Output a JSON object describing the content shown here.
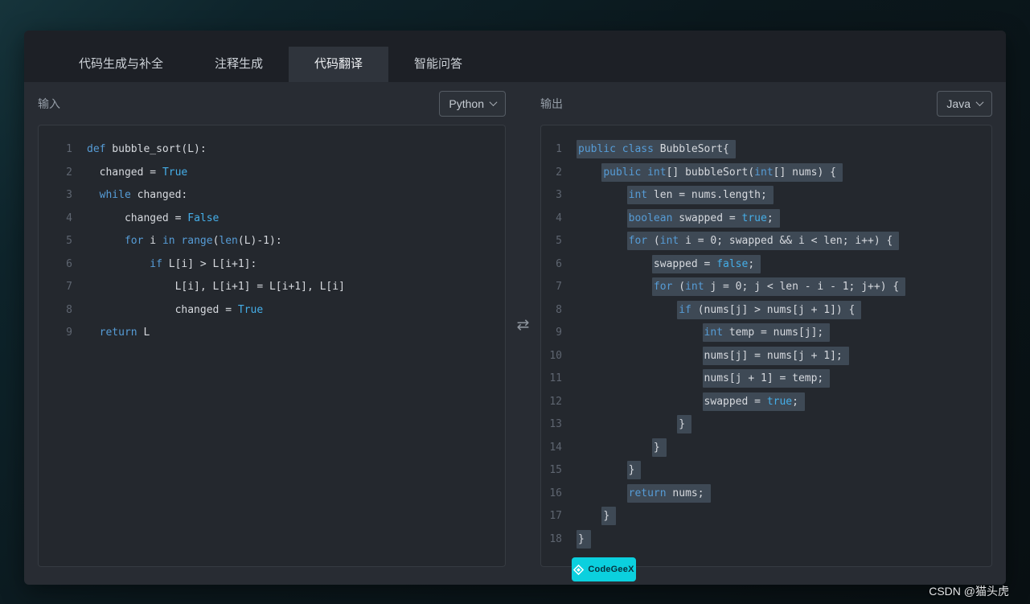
{
  "tabs": [
    {
      "id": "code-generation",
      "label": "代码生成与补全",
      "active": false
    },
    {
      "id": "comment-generation",
      "label": "注释生成",
      "active": false
    },
    {
      "id": "code-translation",
      "label": "代码翻译",
      "active": true
    },
    {
      "id": "smart-qa",
      "label": "智能问答",
      "active": false
    }
  ],
  "panels": {
    "input": {
      "label": "输入",
      "language": "Python",
      "lines": [
        {
          "n": 1,
          "indent": 0,
          "tokens": [
            [
              "k",
              "def"
            ],
            [
              "p",
              " bubble_sort(L):"
            ]
          ]
        },
        {
          "n": 2,
          "indent": 2,
          "tokens": [
            [
              "p",
              "changed = "
            ],
            [
              "l",
              "True"
            ]
          ]
        },
        {
          "n": 3,
          "indent": 2,
          "tokens": [
            [
              "k",
              "while"
            ],
            [
              "p",
              " changed:"
            ]
          ]
        },
        {
          "n": 4,
          "indent": 6,
          "tokens": [
            [
              "p",
              "changed = "
            ],
            [
              "l",
              "False"
            ]
          ]
        },
        {
          "n": 5,
          "indent": 6,
          "tokens": [
            [
              "k",
              "for"
            ],
            [
              "p",
              " i "
            ],
            [
              "k",
              "in"
            ],
            [
              "p",
              " "
            ],
            [
              "k",
              "range"
            ],
            [
              "p",
              "("
            ],
            [
              "k",
              "len"
            ],
            [
              "p",
              "(L)-1):"
            ]
          ]
        },
        {
          "n": 6,
          "indent": 10,
          "tokens": [
            [
              "k",
              "if"
            ],
            [
              "p",
              " L[i] > L[i+1]:"
            ]
          ]
        },
        {
          "n": 7,
          "indent": 14,
          "tokens": [
            [
              "p",
              "L[i], L[i+1] = L[i+1], L[i]"
            ]
          ]
        },
        {
          "n": 8,
          "indent": 14,
          "tokens": [
            [
              "p",
              "changed = "
            ],
            [
              "l",
              "True"
            ]
          ]
        },
        {
          "n": 9,
          "indent": 2,
          "tokens": [
            [
              "k",
              "return"
            ],
            [
              "p",
              " L"
            ]
          ]
        }
      ]
    },
    "output": {
      "label": "输出",
      "language": "Java",
      "lines": [
        {
          "n": 1,
          "indent": 0,
          "tokens": [
            [
              "k",
              "public"
            ],
            [
              "p",
              " "
            ],
            [
              "k",
              "class"
            ],
            [
              "p",
              " BubbleSort{"
            ]
          ]
        },
        {
          "n": 2,
          "indent": 4,
          "tokens": [
            [
              "k",
              "public"
            ],
            [
              "p",
              " "
            ],
            [
              "k",
              "int"
            ],
            [
              "p",
              "[] bubbleSort("
            ],
            [
              "k",
              "int"
            ],
            [
              "p",
              "[] nums) {"
            ]
          ]
        },
        {
          "n": 3,
          "indent": 8,
          "tokens": [
            [
              "k",
              "int"
            ],
            [
              "p",
              " len = nums.length;"
            ]
          ]
        },
        {
          "n": 4,
          "indent": 8,
          "tokens": [
            [
              "k",
              "boolean"
            ],
            [
              "p",
              " swapped = "
            ],
            [
              "l",
              "true"
            ],
            [
              "p",
              ";"
            ]
          ]
        },
        {
          "n": 5,
          "indent": 8,
          "tokens": [
            [
              "k",
              "for"
            ],
            [
              "p",
              " ("
            ],
            [
              "k",
              "int"
            ],
            [
              "p",
              " i = 0; swapped && i < len; i++) {"
            ]
          ]
        },
        {
          "n": 6,
          "indent": 12,
          "tokens": [
            [
              "p",
              "swapped = "
            ],
            [
              "l",
              "false"
            ],
            [
              "p",
              ";"
            ]
          ]
        },
        {
          "n": 7,
          "indent": 12,
          "tokens": [
            [
              "k",
              "for"
            ],
            [
              "p",
              " ("
            ],
            [
              "k",
              "int"
            ],
            [
              "p",
              " j = 0; j < len - i - 1; j++) {"
            ]
          ]
        },
        {
          "n": 8,
          "indent": 16,
          "tokens": [
            [
              "k",
              "if"
            ],
            [
              "p",
              " (nums[j] > nums[j + 1]) {"
            ]
          ]
        },
        {
          "n": 9,
          "indent": 20,
          "tokens": [
            [
              "k",
              "int"
            ],
            [
              "p",
              " temp = nums[j];"
            ]
          ]
        },
        {
          "n": 10,
          "indent": 20,
          "tokens": [
            [
              "p",
              "nums[j] = nums[j + 1];"
            ]
          ]
        },
        {
          "n": 11,
          "indent": 20,
          "tokens": [
            [
              "p",
              "nums[j + 1] = temp;"
            ]
          ]
        },
        {
          "n": 12,
          "indent": 20,
          "tokens": [
            [
              "p",
              "swapped = "
            ],
            [
              "l",
              "true"
            ],
            [
              "p",
              ";"
            ]
          ]
        },
        {
          "n": 13,
          "indent": 16,
          "tokens": [
            [
              "p",
              "}"
            ]
          ]
        },
        {
          "n": 14,
          "indent": 12,
          "tokens": [
            [
              "p",
              "}"
            ]
          ]
        },
        {
          "n": 15,
          "indent": 8,
          "tokens": [
            [
              "p",
              "}"
            ]
          ]
        },
        {
          "n": 16,
          "indent": 8,
          "tokens": [
            [
              "k",
              "return"
            ],
            [
              "p",
              " nums;"
            ]
          ]
        },
        {
          "n": 17,
          "indent": 4,
          "tokens": [
            [
              "p",
              "}"
            ]
          ]
        },
        {
          "n": 18,
          "indent": 0,
          "tokens": [
            [
              "p",
              "}"
            ]
          ]
        }
      ]
    }
  },
  "icons": {
    "swap": "⇄"
  },
  "badge": {
    "label": "CodeGeeX"
  },
  "watermark": "CSDN @猫头虎",
  "colors": {
    "accent_cyan": "#0bd0de",
    "keyword_blue": "#569cd6",
    "literal_blue": "#45aee8",
    "highlight_slate": "#3e4955"
  }
}
